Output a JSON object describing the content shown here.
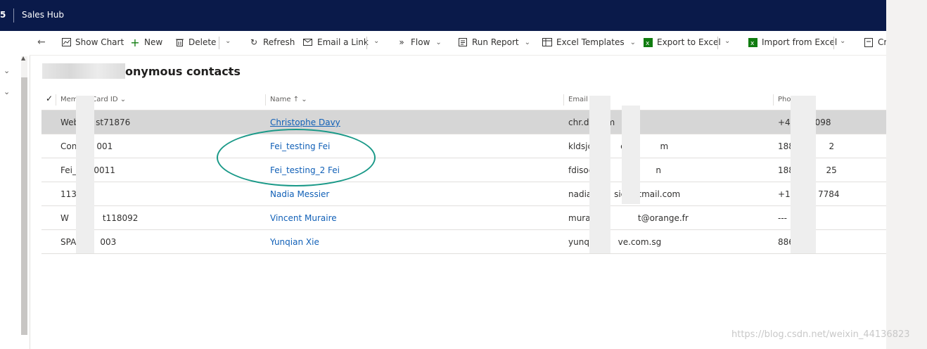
{
  "topbar": {
    "app_number": "5",
    "app_name": "Sales Hub"
  },
  "commands": {
    "show_chart": "Show Chart",
    "new": "New",
    "delete": "Delete",
    "refresh": "Refresh",
    "email_link": "Email a Link",
    "flow": "Flow",
    "run_report": "Run Report",
    "excel_templates": "Excel Templates",
    "export_excel": "Export to Excel",
    "import_excel": "Import from Excel",
    "create_partial": "Cr"
  },
  "view": {
    "title_visible": "onymous contacts"
  },
  "columns": {
    "member_card_id": "Member Card ID",
    "name": "Name",
    "email": "Email",
    "phone": "Phone"
  },
  "rows": [
    {
      "id": "Web",
      "id_tail": "st71876",
      "name": "Christophe Davy",
      "email": "chr.da",
      "email_mid": "gm",
      "email_tail": "m",
      "phone": "+4",
      "phone_tail": "327098"
    },
    {
      "id": "Con",
      "id_tail": "001",
      "name": "Fei_testing Fei",
      "email": "kldsjc",
      "email_mid": "ema",
      "email_tail": "m",
      "phone": "1885",
      "phone_tail": "2"
    },
    {
      "id": "Fei_C",
      "id_tail": "0011",
      "name": "Fei_testing_2 Fei",
      "email": "fdisoc",
      "email_mid": "ma",
      "email_tail": "n",
      "phone": "1885",
      "phone_tail": "25"
    },
    {
      "id": "113",
      "id_tail": "",
      "name": "Nadia Messier",
      "email": "nadia.",
      "email_mid": "sie",
      "email_tail": "otmail.com",
      "phone": "+191",
      "phone_tail": "7784"
    },
    {
      "id": "W",
      "id_tail": "t118092",
      "name": "Vincent Muraire",
      "email": "murai",
      "email_mid": "",
      "email_tail": "t@orange.fr",
      "phone": "---",
      "phone_tail": ""
    },
    {
      "id": "SPA-",
      "id_tail": "003",
      "name": "Yunqian Xie",
      "email": "yunqia",
      "email_mid": "",
      "email_tail": "ve.com.sg",
      "phone": "8866",
      "phone_tail": ""
    }
  ],
  "watermark": "https://blog.csdn.net/weixin_44136823",
  "colors": {
    "topbar": "#0a1a4a",
    "link": "#1160b7",
    "annotation": "#1a9988"
  }
}
